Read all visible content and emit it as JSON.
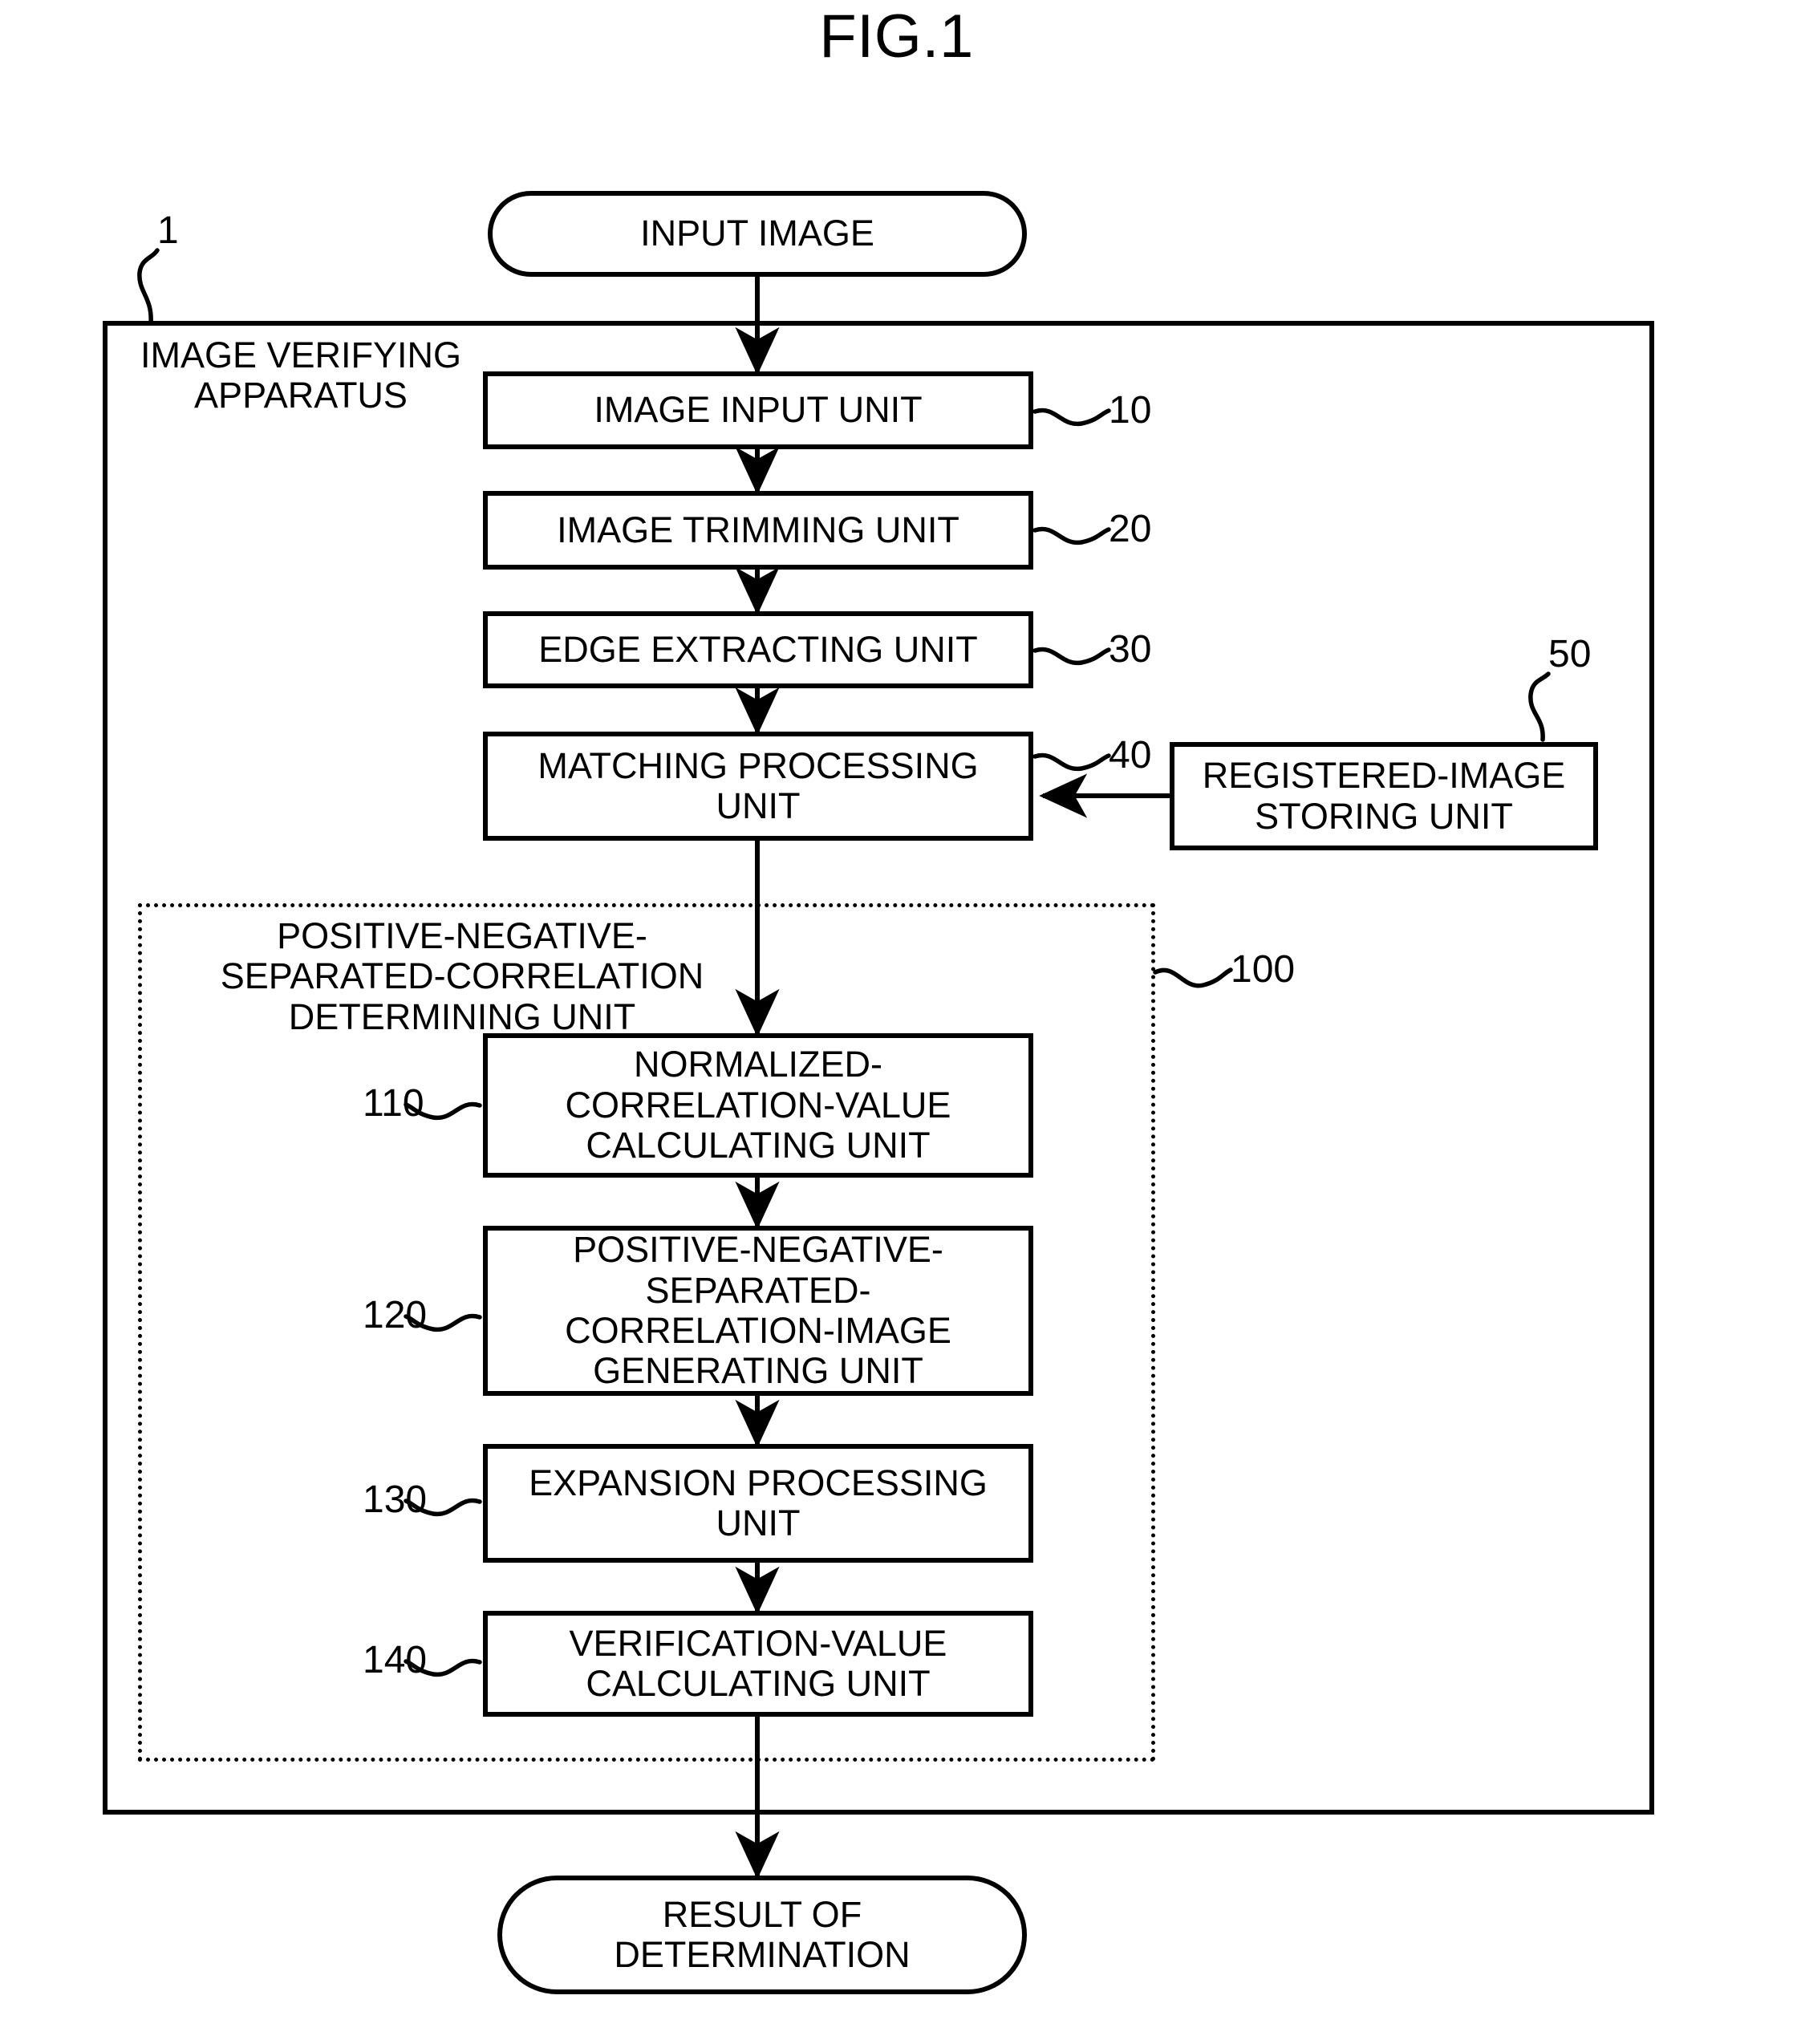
{
  "figure": {
    "title": "FIG.1"
  },
  "terminals": {
    "input": "INPUT IMAGE",
    "output": "RESULT OF\nDETERMINATION"
  },
  "apparatus": {
    "label": "IMAGE VERIFYING\nAPPARATUS",
    "callout": "1"
  },
  "units": [
    {
      "label": "IMAGE INPUT UNIT",
      "callout": "10"
    },
    {
      "label": "IMAGE TRIMMING UNIT",
      "callout": "20"
    },
    {
      "label": "EDGE EXTRACTING UNIT",
      "callout": "30"
    },
    {
      "label": "MATCHING PROCESSING\nUNIT",
      "callout": "40"
    }
  ],
  "storage": {
    "label": "REGISTERED-IMAGE\nSTORING UNIT",
    "callout": "50"
  },
  "determining_unit": {
    "label": "POSITIVE-NEGATIVE-\nSEPARATED-CORRELATION\nDETERMINING UNIT",
    "callout": "100",
    "subunits": [
      {
        "label": "NORMALIZED-\nCORRELATION-VALUE\nCALCULATING UNIT",
        "callout": "110"
      },
      {
        "label": "POSITIVE-NEGATIVE-\nSEPARATED-\nCORRELATION-IMAGE\nGENERATING UNIT",
        "callout": "120"
      },
      {
        "label": "EXPANSION PROCESSING\nUNIT",
        "callout": "130"
      },
      {
        "label": "VERIFICATION-VALUE\nCALCULATING UNIT",
        "callout": "140"
      }
    ]
  },
  "colors": {
    "stroke": "#000000",
    "background": "#ffffff"
  }
}
